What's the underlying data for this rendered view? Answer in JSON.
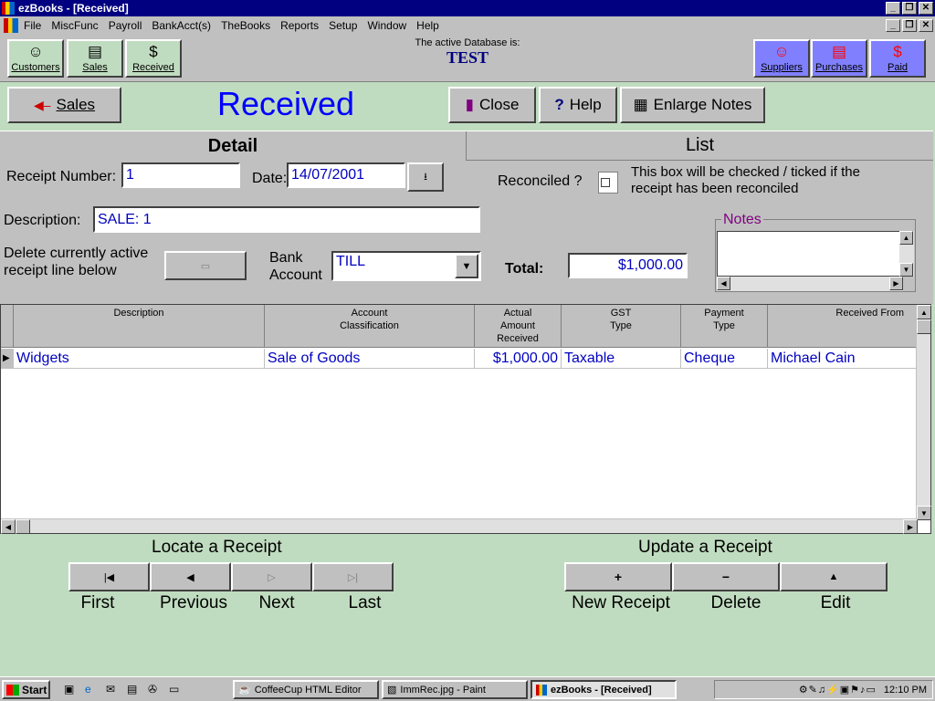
{
  "window": {
    "title": "ezBooks - [Received]"
  },
  "menu": [
    "File",
    "MiscFunc",
    "Payroll",
    "BankAcct(s)",
    "TheBooks",
    "Reports",
    "Setup",
    "Window",
    "Help"
  ],
  "toolbar": {
    "customers": "Customers",
    "sales": "Sales",
    "received": "Received",
    "suppliers": "Suppliers",
    "purchases": "Purchases",
    "paid": "Paid",
    "db_label": "The active Database is:",
    "db_name": "TEST"
  },
  "actions": {
    "back": "Sales",
    "close": "Close",
    "help": "Help",
    "enlarge": "Enlarge Notes"
  },
  "page_title": "Received",
  "tabs": {
    "detail": "Detail",
    "list": "List"
  },
  "form": {
    "receipt_number_label": "Receipt Number:",
    "receipt_number": "1",
    "date_label": "Date:",
    "date": "14/07/2001",
    "reconciled_label": "Reconciled ?",
    "reconciled_hint": "This box will be checked / ticked if the receipt has been reconciled",
    "description_label": "Description:",
    "description": "SALE: 1",
    "delete_label": "Delete currently active receipt line below",
    "bank_label": "Bank Account",
    "bank_value": "TILL",
    "total_label": "Total:",
    "total": "$1,000.00",
    "notes_label": "Notes"
  },
  "grid": {
    "headers": [
      "Description",
      "Account\nClassification",
      "Actual\nAmount\nReceived",
      "GST\nType",
      "Payment\nType",
      "Received From"
    ],
    "rows": [
      [
        "Widgets",
        "Sale of Goods",
        "$1,000.00",
        "Taxable",
        "Cheque",
        "Michael Cain"
      ]
    ]
  },
  "locate": {
    "title": "Locate a Receipt",
    "first": "First",
    "previous": "Previous",
    "next": "Next",
    "last": "Last"
  },
  "update": {
    "title": "Update a Receipt",
    "new": "New Receipt",
    "delete": "Delete",
    "edit": "Edit"
  },
  "taskbar": {
    "start": "Start",
    "tasks": [
      "CoffeeCup HTML Editor",
      "ImmRec.jpg - Paint",
      "ezBooks - [Received]"
    ],
    "clock": "12:10 PM"
  }
}
